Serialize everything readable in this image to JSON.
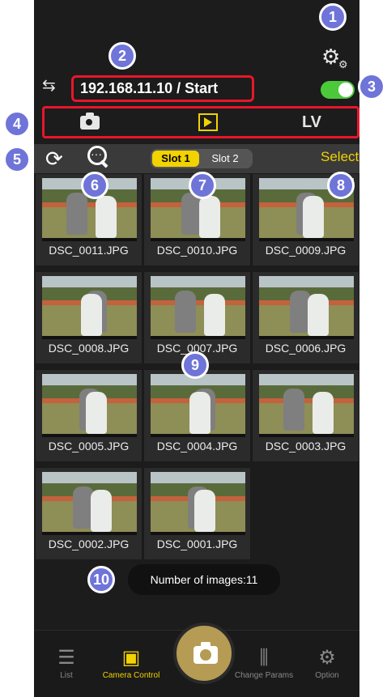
{
  "header": {
    "connection_text": "192.168.11.10 / Start"
  },
  "mode_tabs": {
    "lv_label": "LV"
  },
  "toolbar": {
    "slot1_label": "Slot 1",
    "slot2_label": "Slot 2",
    "select_label": "Select"
  },
  "images": [
    {
      "name": "DSC_0011.JPG"
    },
    {
      "name": "DSC_0010.JPG"
    },
    {
      "name": "DSC_0009.JPG"
    },
    {
      "name": "DSC_0008.JPG"
    },
    {
      "name": "DSC_0007.JPG"
    },
    {
      "name": "DSC_0006.JPG"
    },
    {
      "name": "DSC_0005.JPG"
    },
    {
      "name": "DSC_0004.JPG"
    },
    {
      "name": "DSC_0003.JPG"
    },
    {
      "name": "DSC_0002.JPG"
    },
    {
      "name": "DSC_0001.JPG"
    }
  ],
  "count_label": "Number of images:11",
  "bottom_tabs": [
    {
      "label": "List",
      "icon": "list-icon"
    },
    {
      "label": "Camera Control",
      "icon": "camera-control-icon"
    },
    {
      "label": "Change Params",
      "icon": "sliders-icon"
    },
    {
      "label": "Option",
      "icon": "gear-icon"
    }
  ],
  "callouts": [
    "1",
    "2",
    "3",
    "4",
    "5",
    "6",
    "7",
    "8",
    "9",
    "10"
  ],
  "colors": {
    "accent": "#f2d200",
    "highlight": "#e8162a",
    "callout": "#6f74d8",
    "toggle_on": "#4cc93a"
  }
}
